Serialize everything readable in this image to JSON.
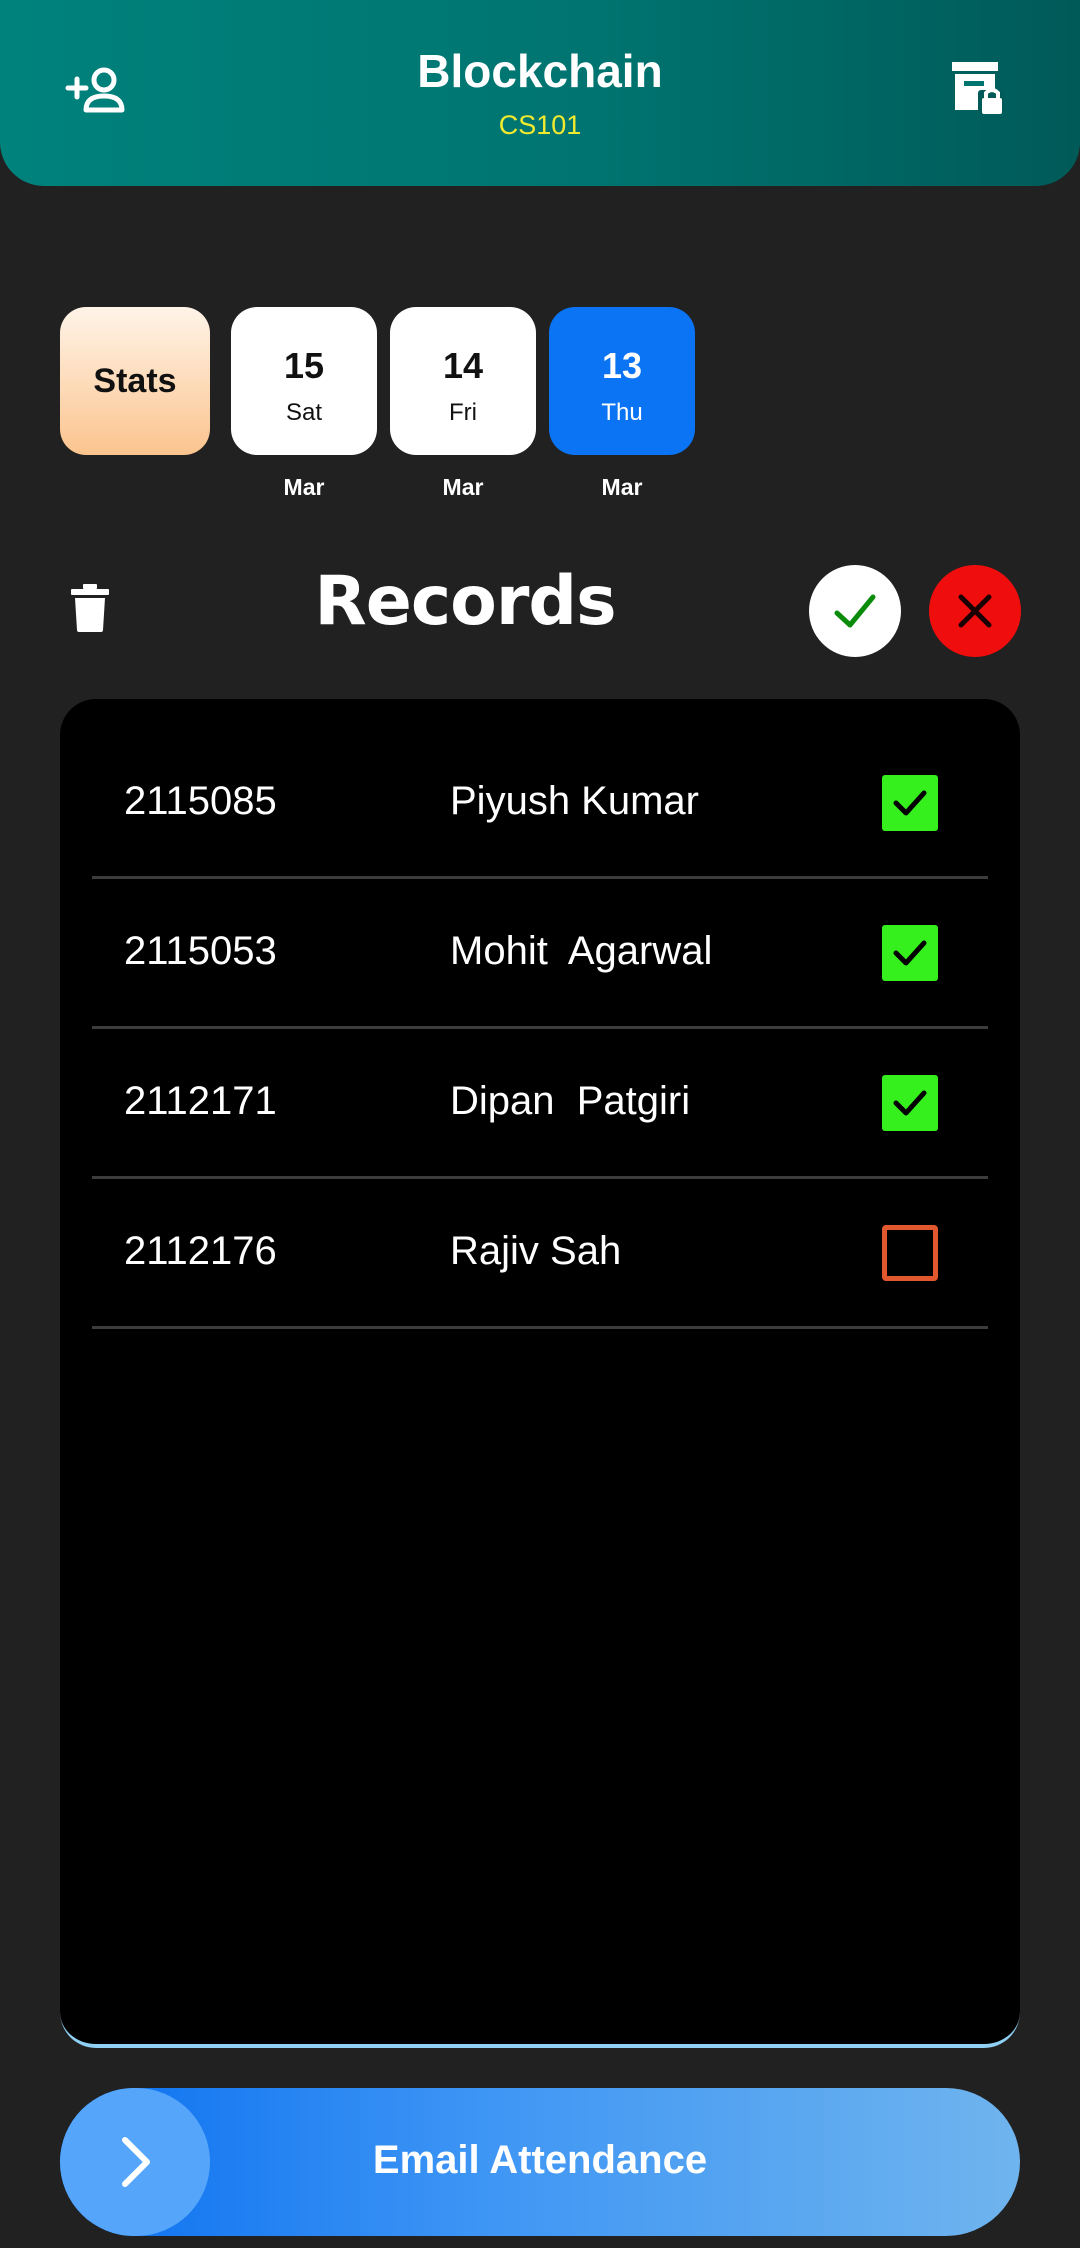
{
  "header": {
    "title": "Blockchain",
    "subtitle": "CS101",
    "left_icon": "add-person-icon",
    "right_icon": "locked-storage-icon"
  },
  "stats_label": "Stats",
  "dates": [
    {
      "num": "15",
      "day": "Sat",
      "month": "Mar",
      "selected": false
    },
    {
      "num": "14",
      "day": "Fri",
      "month": "Mar",
      "selected": false
    },
    {
      "num": "13",
      "day": "Thu",
      "month": "Mar",
      "selected": true
    }
  ],
  "records": {
    "title": "Records",
    "rows": [
      {
        "id": "2115085",
        "name": "Piyush Kumar",
        "present": true
      },
      {
        "id": "2115053",
        "name": "Mohit  Agarwal",
        "present": true
      },
      {
        "id": "2112171",
        "name": "Dipan  Patgiri",
        "present": true
      },
      {
        "id": "2112176",
        "name": "Rajiv Sah",
        "present": false
      }
    ]
  },
  "email_button": {
    "label": "Email Attendance"
  },
  "colors": {
    "header": "#007470",
    "subtitle": "#f2ea2e",
    "selected_date": "#0a74f4",
    "check_on": "#35f01d",
    "check_off": "#e2582e",
    "reject": "#f00d0d"
  }
}
